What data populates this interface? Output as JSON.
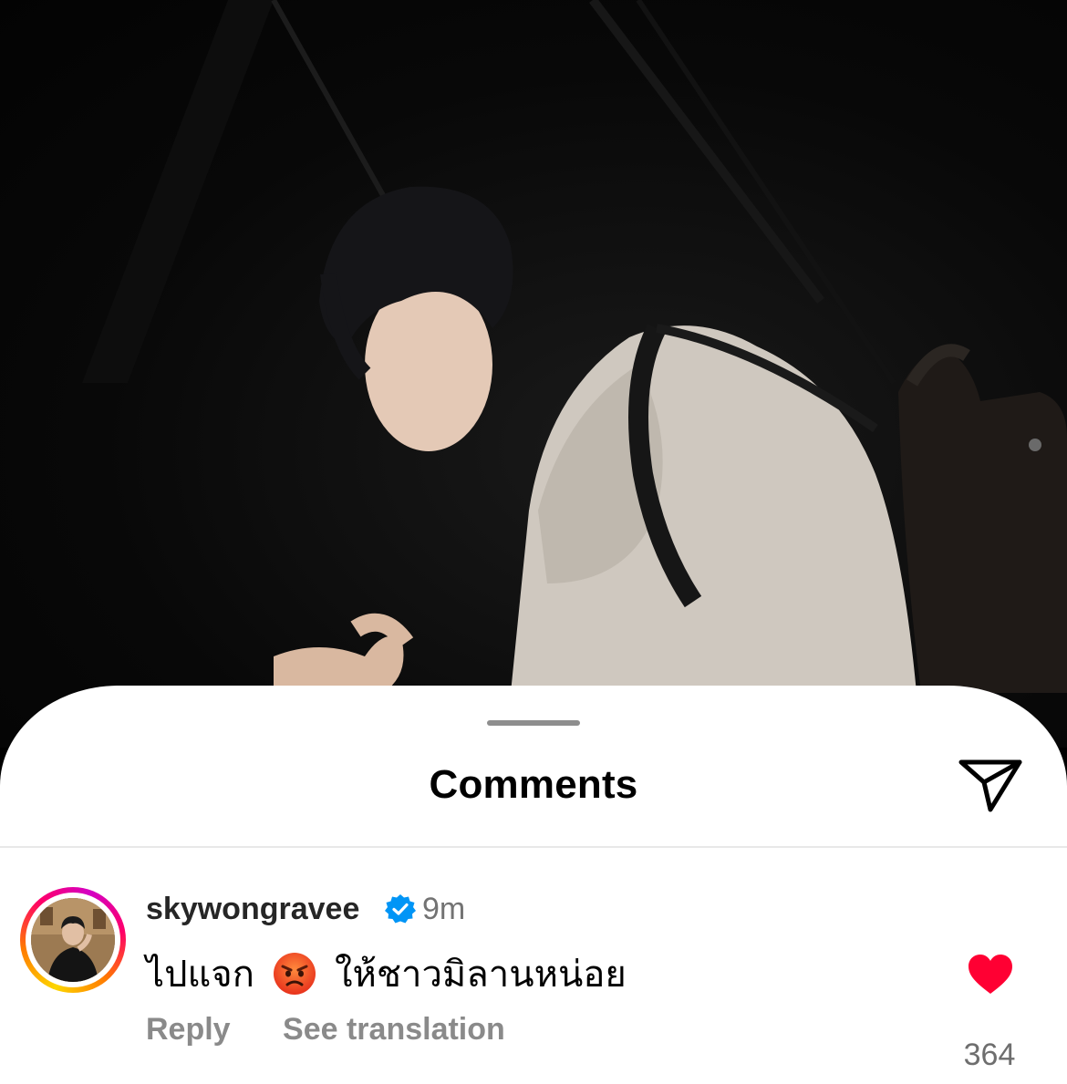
{
  "sheet": {
    "title": "Comments"
  },
  "comment": {
    "username": "skywongravee",
    "time": "9m",
    "text_before": "ไปแจก",
    "emoji": "angry-face",
    "text_after": "ให้ชาวมิลานหน่อย",
    "reply_label": "Reply",
    "translate_label": "See translation",
    "like_count": "364"
  },
  "colors": {
    "like": "#ff0033",
    "verified": "#0095f6"
  },
  "icons": [
    "send-icon",
    "verified-badge-icon",
    "angry-face-emoji",
    "heart-icon"
  ]
}
